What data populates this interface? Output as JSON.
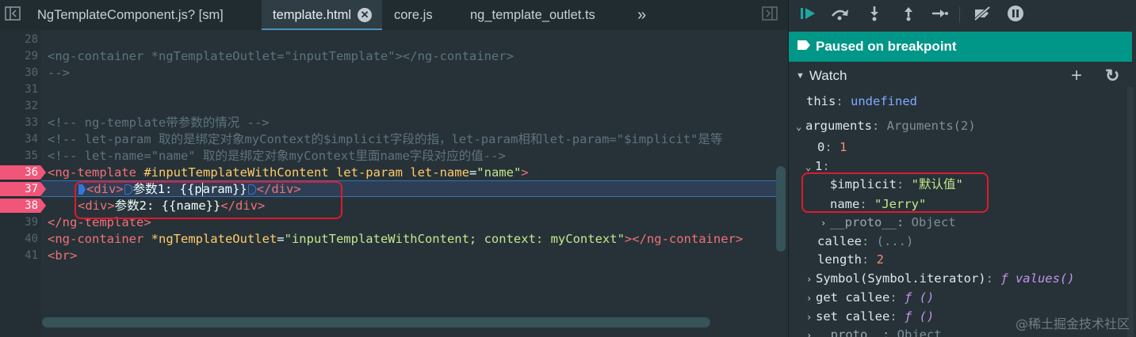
{
  "tabs": [
    {
      "label": "NgTemplateComponent.js? [sm]"
    },
    {
      "label": "template.html"
    },
    {
      "label": "core.js"
    },
    {
      "label": "ng_template_outlet.ts"
    }
  ],
  "tabs_overflow": "»",
  "close_glyph": "✕",
  "lines": [
    {
      "n": "28"
    },
    {
      "n": "29",
      "t1": "<ng-container *ngTemplateOutlet=\"inputTemplate\"></ng-container>"
    },
    {
      "n": "30",
      "t1": "-->"
    },
    {
      "n": "31"
    },
    {
      "n": "32"
    },
    {
      "n": "33",
      "t1": "<!-- ng-template带参数的情况 -->"
    },
    {
      "n": "34",
      "t1": "<!-- let-param 取的是绑定对象myContext的$implicit字段的指，let-param相和let-param=\"$implicit\"是等"
    },
    {
      "n": "35",
      "t1": "<!-- let-name=\"name\" 取的是绑定对象myContext里面name字段对应的值-->"
    },
    {
      "n": "36",
      "t1": "<ng-template ",
      "t2": "#inputTemplateWithContent let-param let-name",
      "t3": "=",
      "t4": "\"name\"",
      "t5": ">"
    },
    {
      "n": "37",
      "t1": "<div>",
      "t2": "参数1: {{p",
      "t3": "aram}}",
      "t4": "</div>"
    },
    {
      "n": "38",
      "t1": "<div>",
      "t2": "参数2: {{name}}",
      "t3": "</div>"
    },
    {
      "n": "39",
      "t1": "</ng-template>"
    },
    {
      "n": "40",
      "t1": "<ng-container ",
      "t2": "*ngTemplateOutlet",
      "t3": "=",
      "t4": "\"inputTemplateWithContent; context: myContext\"",
      "t5": "></ng-container>"
    },
    {
      "n": "41",
      "t1": "<br>"
    }
  ],
  "debugger": {
    "paused_label": "Paused on breakpoint",
    "watch_label": "Watch",
    "add_glyph": "+",
    "refresh_glyph": "↻",
    "rows": {
      "this_key": "this",
      "this_val": "undefined",
      "args_key": "arguments",
      "args_val": "Arguments(2)",
      "zero_key": "0",
      "zero_val": "1",
      "one_key": "1",
      "implicit_key": "$implicit",
      "implicit_val": "\"默认值\"",
      "name_key": "name",
      "name_val": "\"Jerry\"",
      "proto_key": "__proto__",
      "proto_val": "Object",
      "callee_key": "callee",
      "callee_val": "(...)",
      "length_key": "length",
      "length_val": "2",
      "symbol_key": "Symbol(Symbol.iterator)",
      "symbol_val": "ƒ values()",
      "get_key": "get callee",
      "get_val": "ƒ ()",
      "set_key": "set callee",
      "set_val": "ƒ ()",
      "proto2_key": "__proto__",
      "proto2_val": "Object"
    },
    "colon": ": "
  },
  "watermark": "@稀土掘金技术社区",
  "colors": {
    "paused_bg": "#009688",
    "breakpoint": "#f2557a",
    "highlight_box": "#e0192d"
  }
}
